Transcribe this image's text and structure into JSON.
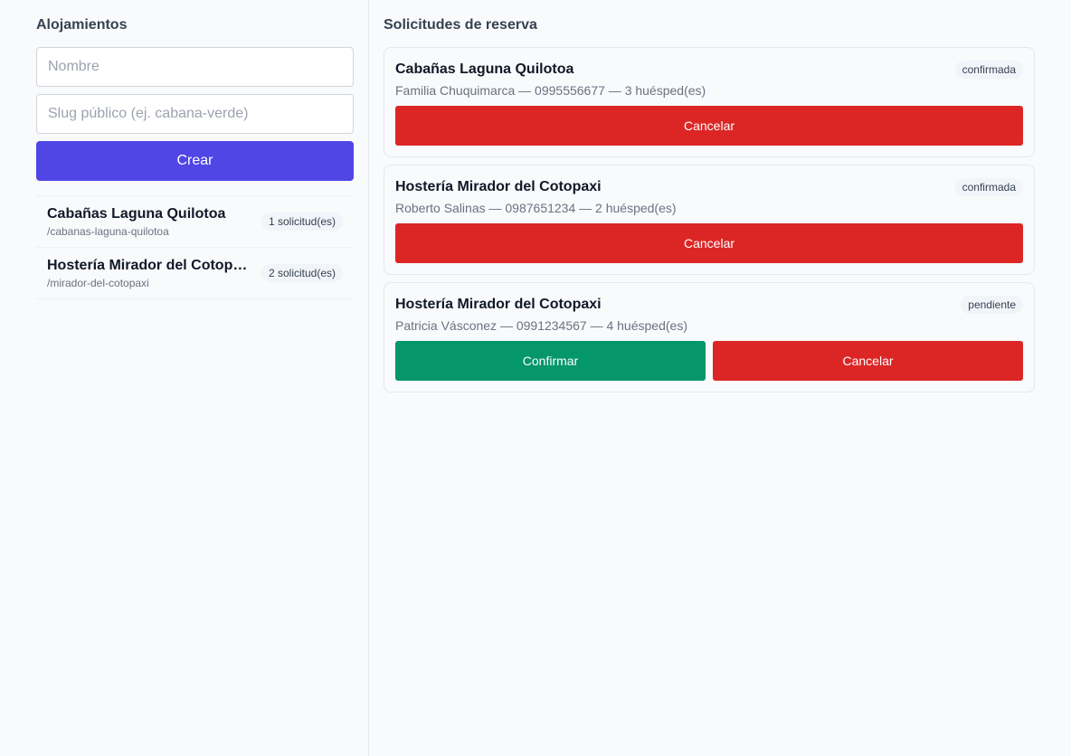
{
  "sidebar": {
    "title": "Alojamientos",
    "name_placeholder": "Nombre",
    "slug_placeholder": "Slug público (ej. cabana-verde)",
    "create_label": "Crear",
    "accommodations": [
      {
        "name": "Cabañas Laguna Quilotoa",
        "slug": "/cabanas-laguna-quilotoa",
        "count": "1 solicitud(es)"
      },
      {
        "name": "Hostería Mirador del Cotopaxi",
        "slug": "/mirador-del-cotopaxi",
        "count": "2 solicitud(es)"
      }
    ]
  },
  "main": {
    "title": "Solicitudes de reserva",
    "requests": [
      {
        "property": "Cabañas Laguna Quilotoa",
        "details": "Familia Chuquimarca — 0995556677 — 3 huésped(es)",
        "status": "confirmada",
        "cancel_label": "Cancelar"
      },
      {
        "property": "Hostería Mirador del Cotopaxi",
        "details": "Roberto Salinas — 0987651234 — 2 huésped(es)",
        "status": "confirmada",
        "cancel_label": "Cancelar"
      },
      {
        "property": "Hostería Mirador del Cotopaxi",
        "details": "Patricia Vásconez — 0991234567 — 4 huésped(es)",
        "status": "pendiente",
        "confirm_label": "Confirmar",
        "cancel_label": "Cancelar"
      }
    ]
  },
  "colors": {
    "primary": "#4f46e5",
    "danger": "#dc2626",
    "success": "#059669",
    "background": "#f8fafc"
  }
}
